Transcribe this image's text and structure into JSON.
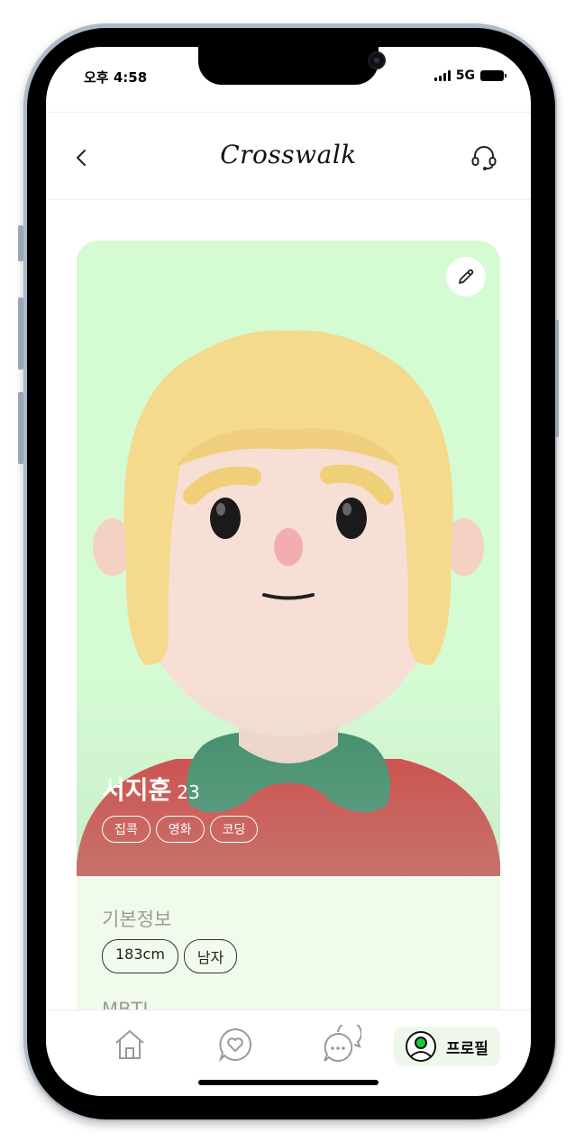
{
  "status_bar": {
    "time": "오후 4:58",
    "network": "5G"
  },
  "header": {
    "title": "Crosswalk",
    "back_icon": "chevron-left-icon",
    "support_icon": "headset-icon"
  },
  "profile": {
    "name": "서지훈",
    "age": "23",
    "interests": [
      "집콕",
      "영화",
      "코딩"
    ],
    "edit_icon": "pencil-icon",
    "avatar": "3d-avatar-blonde-bob-red-shirt-green-collar"
  },
  "basic_info": {
    "title": "기본정보",
    "chips": [
      "183cm",
      "남자"
    ]
  },
  "mbti": {
    "title": "MBTI"
  },
  "tab_bar": {
    "items": [
      {
        "icon": "home-icon"
      },
      {
        "icon": "heart-chat-icon"
      },
      {
        "icon": "chat-bubbles-icon"
      },
      {
        "icon": "profile-avatar-icon",
        "label": "프로필",
        "active": true
      }
    ]
  },
  "colors": {
    "card_bg": "#d5fbd3",
    "info_bg": "#f1fbec",
    "accent_green": "#1ec836",
    "tab_active_bg": "#eef8ea"
  }
}
